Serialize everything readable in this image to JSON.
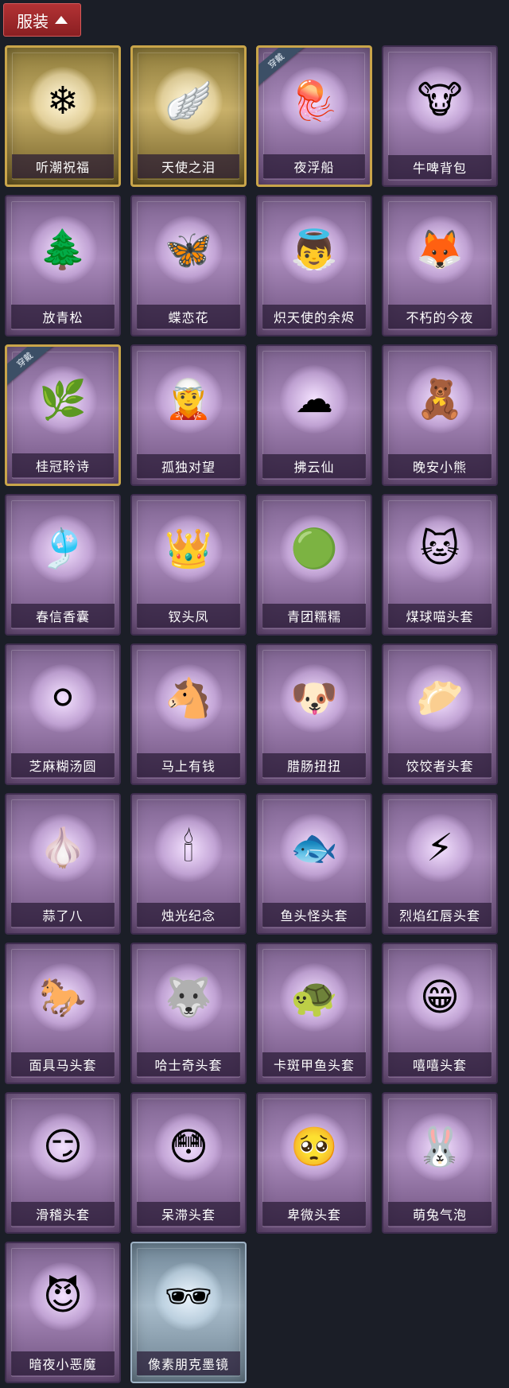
{
  "header": {
    "title": "服装",
    "chevron_icon": "chevron-up-icon",
    "color": "#a02a2d"
  },
  "badges": {
    "equipped": "穿戴"
  },
  "items": [
    {
      "name": "听潮祝福",
      "tier": "gold",
      "icon": "ice-crystal-icon",
      "glyph": "❄"
    },
    {
      "name": "天使之泪",
      "tier": "gold",
      "icon": "angel-wings-icon",
      "glyph": "🪽"
    },
    {
      "name": "夜浮船",
      "tier": "purple",
      "equipped": true,
      "icon": "jellyfish-icon",
      "glyph": "🪼"
    },
    {
      "name": "牛啤背包",
      "tier": "purple",
      "icon": "cow-beer-icon",
      "glyph": "🐮"
    },
    {
      "name": "放青松",
      "tier": "purple",
      "icon": "bonsai-icon",
      "glyph": "🌲"
    },
    {
      "name": "蝶恋花",
      "tier": "purple",
      "icon": "butterfly-bell-icon",
      "glyph": "🦋"
    },
    {
      "name": "炽天使的余烬",
      "tier": "purple",
      "icon": "angel-doll-icon",
      "glyph": "👼"
    },
    {
      "name": "不朽的今夜",
      "tier": "purple",
      "icon": "fox-cup-icon",
      "glyph": "🦊"
    },
    {
      "name": "桂冠聆诗",
      "tier": "purple",
      "equipped": true,
      "icon": "laurel-doll-icon",
      "glyph": "🌿"
    },
    {
      "name": "孤独对望",
      "tier": "purple",
      "icon": "silver-doll-icon",
      "glyph": "🧝"
    },
    {
      "name": "拂云仙",
      "tier": "purple",
      "icon": "cloud-fairy-icon",
      "glyph": "☁"
    },
    {
      "name": "晚安小熊",
      "tier": "purple",
      "icon": "teddy-bear-icon",
      "glyph": "🧸"
    },
    {
      "name": "春信香囊",
      "tier": "purple",
      "icon": "sachet-icon",
      "glyph": "🎐"
    },
    {
      "name": "钗头凤",
      "tier": "purple",
      "icon": "phoenix-crown-icon",
      "glyph": "👑"
    },
    {
      "name": "青团糯糯",
      "tier": "purple",
      "icon": "green-dumpling-icon",
      "glyph": "🟢"
    },
    {
      "name": "煤球喵头套",
      "tier": "purple",
      "icon": "black-cat-icon",
      "glyph": "🐱"
    },
    {
      "name": "芝麻糊汤圆",
      "tier": "purple",
      "icon": "rice-ball-icon",
      "glyph": "⚪"
    },
    {
      "name": "马上有钱",
      "tier": "purple",
      "icon": "red-horse-icon",
      "glyph": "🐴"
    },
    {
      "name": "腊肠扭扭",
      "tier": "purple",
      "icon": "dachshund-icon",
      "glyph": "🐶"
    },
    {
      "name": "饺饺者头套",
      "tier": "purple",
      "icon": "dumpling-icon",
      "glyph": "🥟"
    },
    {
      "name": "蒜了八",
      "tier": "purple",
      "icon": "garlic-icon",
      "glyph": "🧄"
    },
    {
      "name": "烛光纪念",
      "tier": "purple",
      "icon": "candle-icon",
      "glyph": "🕯"
    },
    {
      "name": "鱼头怪头套",
      "tier": "purple",
      "icon": "fish-head-icon",
      "glyph": "🐟"
    },
    {
      "name": "烈焰红唇头套",
      "tier": "purple",
      "icon": "pikachu-mask-icon",
      "glyph": "⚡"
    },
    {
      "name": "面具马头套",
      "tier": "purple",
      "icon": "horse-mask-icon",
      "glyph": "🐎"
    },
    {
      "name": "哈士奇头套",
      "tier": "purple",
      "icon": "husky-icon",
      "glyph": "🐺"
    },
    {
      "name": "卡斑甲鱼头套",
      "tier": "purple",
      "icon": "turtle-icon",
      "glyph": "🐢"
    },
    {
      "name": "嘻嘻头套",
      "tier": "purple",
      "icon": "grin-emoji-icon",
      "glyph": "😁"
    },
    {
      "name": "滑稽头套",
      "tier": "purple",
      "icon": "smirk-emoji-icon",
      "glyph": "😏"
    },
    {
      "name": "呆滞头套",
      "tier": "purple",
      "icon": "stunned-emoji-icon",
      "glyph": "😳"
    },
    {
      "name": "卑微头套",
      "tier": "purple",
      "icon": "pleading-emoji-icon",
      "glyph": "🥺"
    },
    {
      "name": "萌兔气泡",
      "tier": "purple",
      "icon": "bunny-bubble-icon",
      "glyph": "🐰"
    },
    {
      "name": "暗夜小恶魔",
      "tier": "purple",
      "icon": "little-devil-icon",
      "glyph": "😈"
    },
    {
      "name": "像素朋克墨镜",
      "tier": "ghost",
      "icon": "pixel-sunglasses-icon",
      "glyph": "🕶"
    }
  ]
}
